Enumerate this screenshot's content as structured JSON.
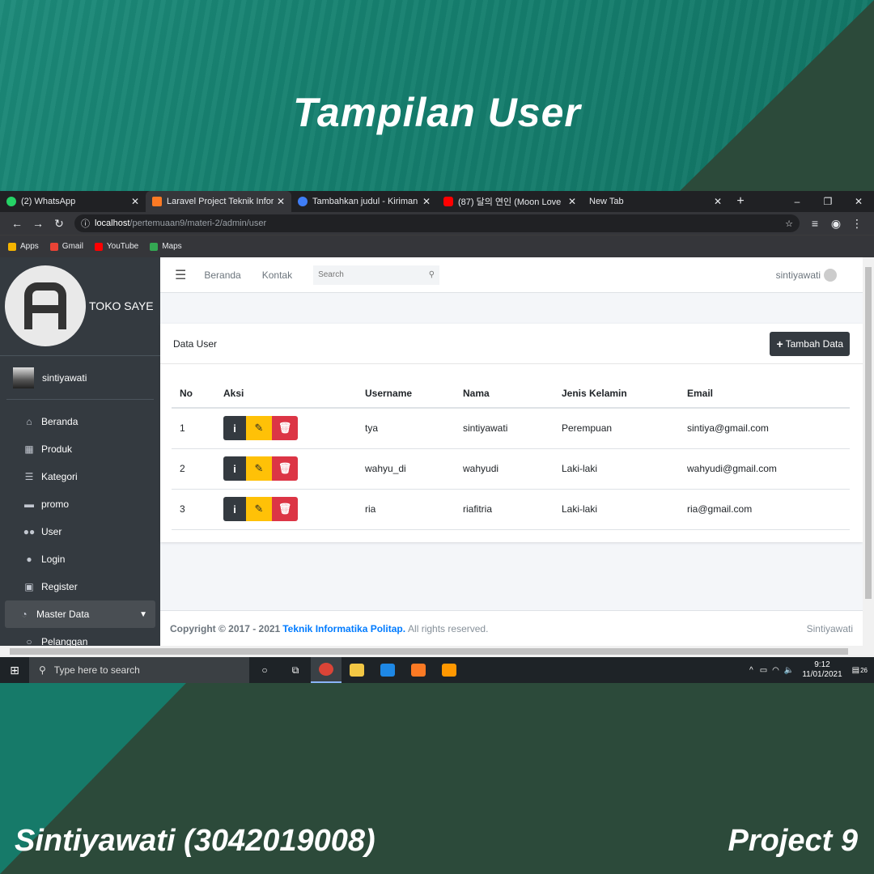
{
  "poster": {
    "title": "Tampilan User",
    "author": "Sintiyawati (3042019008)",
    "project": "Project 9"
  },
  "browser": {
    "tabs": [
      {
        "title": "(2) WhatsApp",
        "icon": "whatsapp-icon",
        "color": "#25d366"
      },
      {
        "title": "Laravel Project Teknik Informat",
        "icon": "xampp-icon",
        "color": "#fb7a24",
        "active": true
      },
      {
        "title": "Tambahkan judul - Kiriman Ins",
        "icon": "canva-icon",
        "color": "#3f7ef7"
      },
      {
        "title": "(87) 달의 연인 (Moon Love",
        "icon": "youtube-icon",
        "color": "#ff0000"
      },
      {
        "title": "New Tab",
        "icon": "",
        "color": ""
      }
    ],
    "url_host": "localhost",
    "url_path": "/pertemuaan9/materi-2/admin/user",
    "bookmarks": [
      {
        "label": "Apps",
        "color": "#f4b400"
      },
      {
        "label": "Gmail",
        "color": "#ea4335"
      },
      {
        "label": "YouTube",
        "color": "#ff0000"
      },
      {
        "label": "Maps",
        "color": "#34a853"
      }
    ]
  },
  "sidebar": {
    "brand": "TOKO SAYE",
    "user": "sintiyawati",
    "items": [
      {
        "label": "Beranda",
        "icon": "home-icon",
        "glyph": "⌂"
      },
      {
        "label": "Produk",
        "icon": "grid-icon",
        "glyph": "▦"
      },
      {
        "label": "Kategori",
        "icon": "list-icon",
        "glyph": "☰"
      },
      {
        "label": "promo",
        "icon": "card-icon",
        "glyph": "▬"
      },
      {
        "label": "User",
        "icon": "users-icon",
        "glyph": "👥"
      },
      {
        "label": "Login",
        "icon": "user-icon",
        "glyph": "●"
      },
      {
        "label": "Register",
        "icon": "id-card-icon",
        "glyph": "▣"
      },
      {
        "label": "Master Data",
        "icon": "dashboard-icon",
        "glyph": "◔",
        "active": true
      },
      {
        "label": "Pelanggan",
        "icon": "circle-icon",
        "glyph": "○"
      }
    ]
  },
  "navbar": {
    "links": [
      "Beranda",
      "Kontak"
    ],
    "search_placeholder": "Search",
    "user": "sintiyawati"
  },
  "card": {
    "title": "Data User",
    "add_button": "Tambah Data",
    "columns": [
      "No",
      "Aksi",
      "Username",
      "Nama",
      "Jenis Kelamin",
      "Email"
    ],
    "rows": [
      {
        "no": "1",
        "username": "tya",
        "nama": "sintiyawati",
        "jk": "Perempuan",
        "email": "sintiya@gmail.com"
      },
      {
        "no": "2",
        "username": "wahyu_di",
        "nama": "wahyudi",
        "jk": "Laki-laki",
        "email": "wahyudi@gmail.com"
      },
      {
        "no": "3",
        "username": "ria",
        "nama": "riafitria",
        "jk": "Laki-laki",
        "email": "ria@gmail.com"
      }
    ]
  },
  "footer": {
    "copyright": "Copyright © 2017 - 2021",
    "brand": "Teknik Informatika Politap.",
    "rights": "All rights reserved.",
    "right": "Sintiyawati"
  },
  "taskbar": {
    "search_placeholder": "Type here to search",
    "time": "9:12",
    "date": "11/01/2021",
    "notifications": "26"
  }
}
